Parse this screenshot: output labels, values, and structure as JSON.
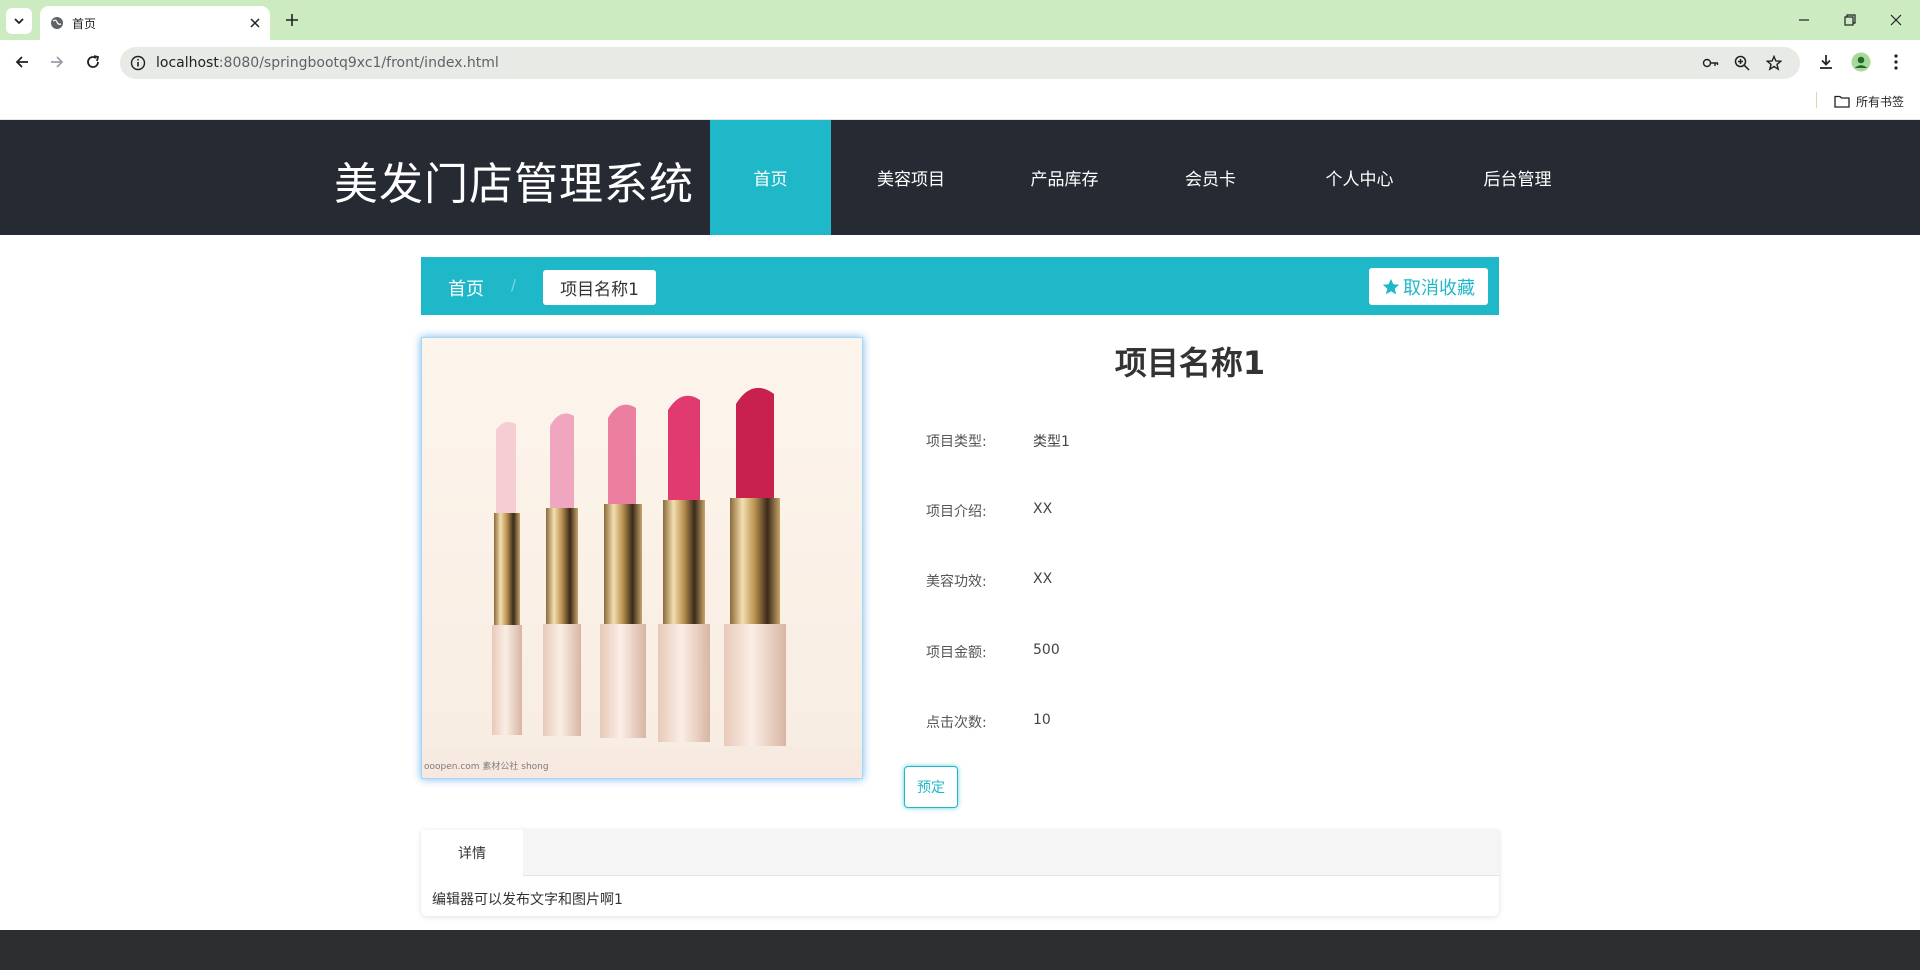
{
  "browser": {
    "tab_title": "首页",
    "url_host": "localhost",
    "url_rest": ":8080/springbootq9xc1/front/index.html",
    "bookmarks_all": "所有书签"
  },
  "site": {
    "logo": "美发门店管理系统",
    "menu": [
      {
        "label": "首页",
        "active": true
      },
      {
        "label": "美容项目",
        "active": false
      },
      {
        "label": "产品库存",
        "active": false
      },
      {
        "label": "会员卡",
        "active": false
      },
      {
        "label": "个人中心",
        "active": false
      },
      {
        "label": "后台管理",
        "active": false
      }
    ],
    "accent_color": "#1fb8c9",
    "header_color": "#262a33"
  },
  "breadcrumb": {
    "home": "首页",
    "separator": "/",
    "current": "项目名称1",
    "favorite_button": "取消收藏"
  },
  "product": {
    "title": "项目名称1",
    "image_caption": "ooopen.com 素材公社 shong",
    "fields": [
      {
        "label": "项目类型:",
        "value": "类型1"
      },
      {
        "label": "项目介绍:",
        "value": "XX"
      },
      {
        "label": "美容功效:",
        "value": "XX"
      },
      {
        "label": "项目金额:",
        "value": "500"
      },
      {
        "label": "点击次数:",
        "value": "10"
      }
    ],
    "book_button": "预定"
  },
  "detail": {
    "tab": "详情",
    "content": "编辑器可以发布文字和图片啊1"
  }
}
